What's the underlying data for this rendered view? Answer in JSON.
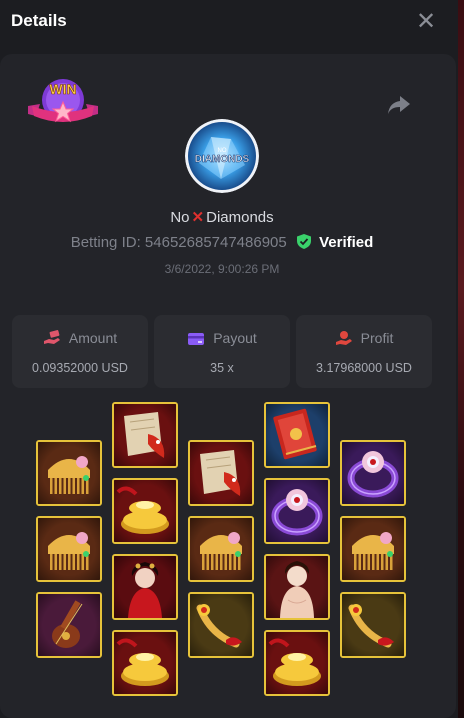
{
  "header": {
    "title": "Details",
    "close_icon": "close-icon",
    "close_glyph": "✕"
  },
  "badge": {
    "text": "WIN"
  },
  "logo": {
    "text_small": "NO",
    "text_main": "DIAMONDS"
  },
  "game": {
    "name_left": "No",
    "name_sep": "✕",
    "name_right": "Diamonds"
  },
  "bet": {
    "id_label": "Betting ID:",
    "id_value": "54652685747486905",
    "verified_label": "Verified"
  },
  "timestamp": "3/6/2022, 9:00:26 PM",
  "stats": {
    "amount": {
      "label": "Amount",
      "value": "0.09352000 USD",
      "icon": "hand-money-icon",
      "color": "#e0566b"
    },
    "payout": {
      "label": "Payout",
      "value": "35 x",
      "icon": "card-icon",
      "color": "#8a5cf6"
    },
    "profit": {
      "label": "Profit",
      "value": "3.17968000 USD",
      "icon": "coins-hand-icon",
      "color": "#e0473e"
    }
  },
  "reels": [
    [
      "comb",
      "comb",
      "lute"
    ],
    [
      "scroll",
      "gold",
      "lady-red",
      "gold"
    ],
    [
      "scroll",
      "comb",
      "hairpin"
    ],
    [
      "book",
      "ring",
      "lady-pale",
      "gold"
    ],
    [
      "ring",
      "comb",
      "hairpin"
    ]
  ],
  "colors": {
    "accent_gold": "#e6c33a",
    "verified_green": "#3ad16b",
    "background": "#1c1d21",
    "card": "#232429"
  }
}
